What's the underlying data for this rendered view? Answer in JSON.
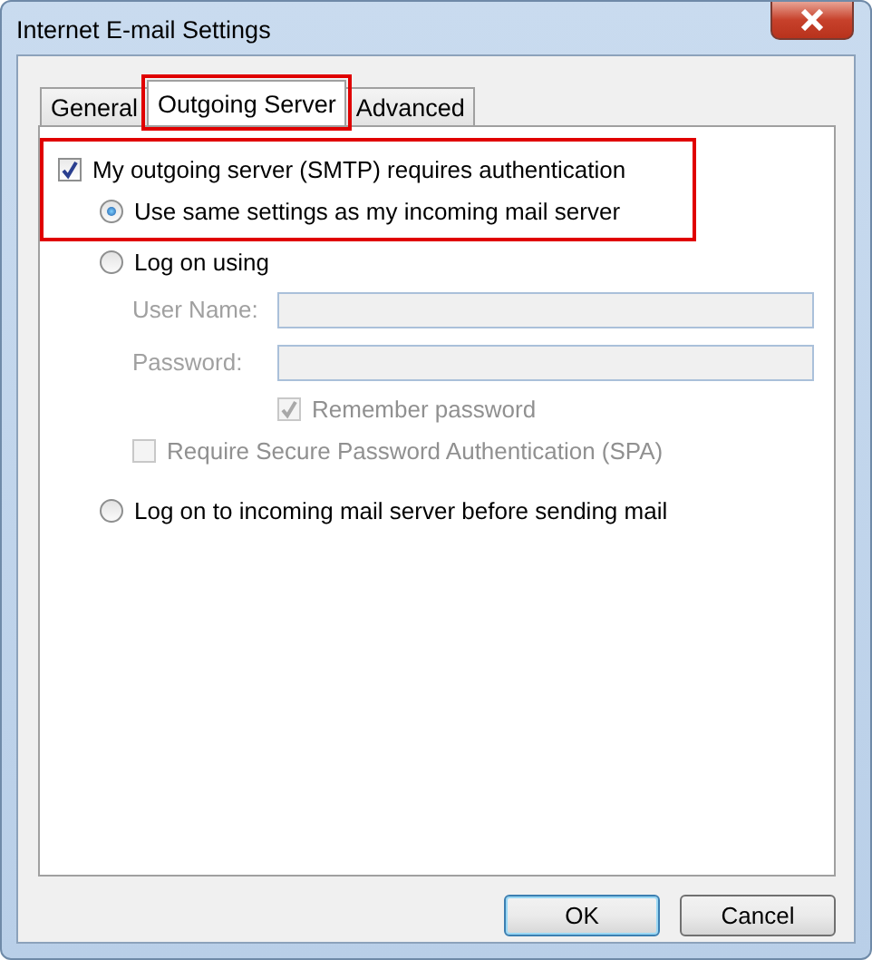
{
  "window": {
    "title": "Internet E-mail Settings"
  },
  "tabs": [
    {
      "label": "General",
      "selected": false,
      "highlighted": false
    },
    {
      "label": "Outgoing Server",
      "selected": true,
      "highlighted": true
    },
    {
      "label": "Advanced",
      "selected": false,
      "highlighted": false
    }
  ],
  "auth": {
    "label": "My outgoing server (SMTP) requires authentication",
    "checked": true,
    "highlighted": true
  },
  "radios": [
    {
      "label": "Use same settings as my incoming mail server",
      "selected": true
    },
    {
      "label": "Log on using",
      "selected": false
    },
    {
      "label": "Log on to incoming mail server before sending mail",
      "selected": false
    }
  ],
  "credentials": {
    "fields": [
      {
        "label": "User Name:",
        "disabled": true
      },
      {
        "label": "Password:",
        "disabled": true
      }
    ],
    "remember": {
      "label": "Remember password",
      "checked": true,
      "disabled": true
    },
    "spa": {
      "label": "Require Secure Password Authentication (SPA)",
      "checked": false,
      "disabled": true
    }
  },
  "buttons": [
    {
      "label": "OK",
      "default": true
    },
    {
      "label": "Cancel",
      "default": false
    }
  ]
}
